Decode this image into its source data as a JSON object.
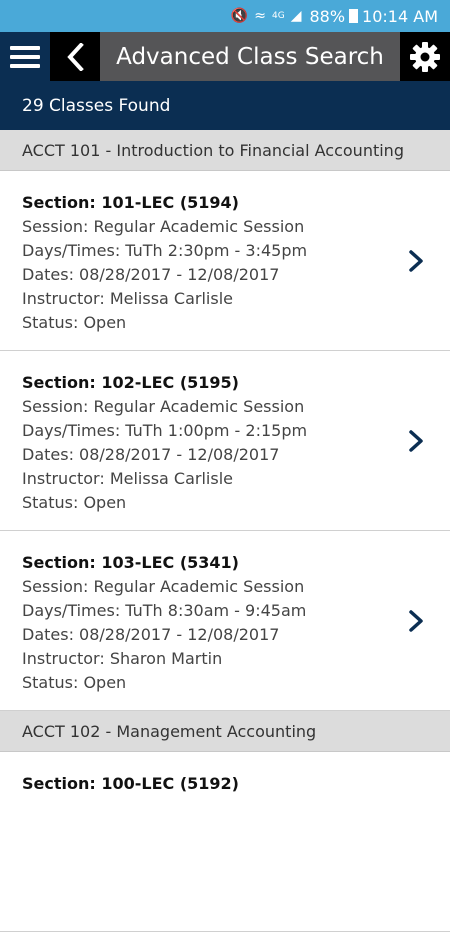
{
  "status_bar": {
    "battery": "88%",
    "time": "10:14 AM",
    "network": "4G"
  },
  "header": {
    "title": "Advanced Class Search"
  },
  "results": {
    "count_text": "29 Classes Found"
  },
  "courses": [
    {
      "name": "ACCT 101 - Introduction to Financial Accounting",
      "sections": [
        {
          "section": "Section: 101-LEC (5194)",
          "session": "Session: Regular Academic Session",
          "days_times": "Days/Times: TuTh 2:30pm - 3:45pm",
          "dates": "Dates: 08/28/2017 - 12/08/2017",
          "instructor": "Instructor: Melissa Carlisle",
          "status": "Status: Open"
        },
        {
          "section": "Section: 102-LEC (5195)",
          "session": "Session: Regular Academic Session",
          "days_times": "Days/Times: TuTh 1:00pm - 2:15pm",
          "dates": "Dates: 08/28/2017 - 12/08/2017",
          "instructor": "Instructor: Melissa Carlisle",
          "status": "Status: Open"
        },
        {
          "section": "Section: 103-LEC (5341)",
          "session": "Session: Regular Academic Session",
          "days_times": "Days/Times: TuTh 8:30am - 9:45am",
          "dates": "Dates: 08/28/2017 - 12/08/2017",
          "instructor": "Instructor: Sharon Martin",
          "status": "Status: Open"
        }
      ]
    },
    {
      "name": "ACCT 102 - Management Accounting",
      "sections": [
        {
          "section": "Section: 100-LEC (5192)"
        }
      ]
    }
  ],
  "colors": {
    "status_bar": "#4aa9d8",
    "navy": "#0b2e52",
    "title_bg": "#555557",
    "course_header_bg": "#dcdcdc"
  }
}
